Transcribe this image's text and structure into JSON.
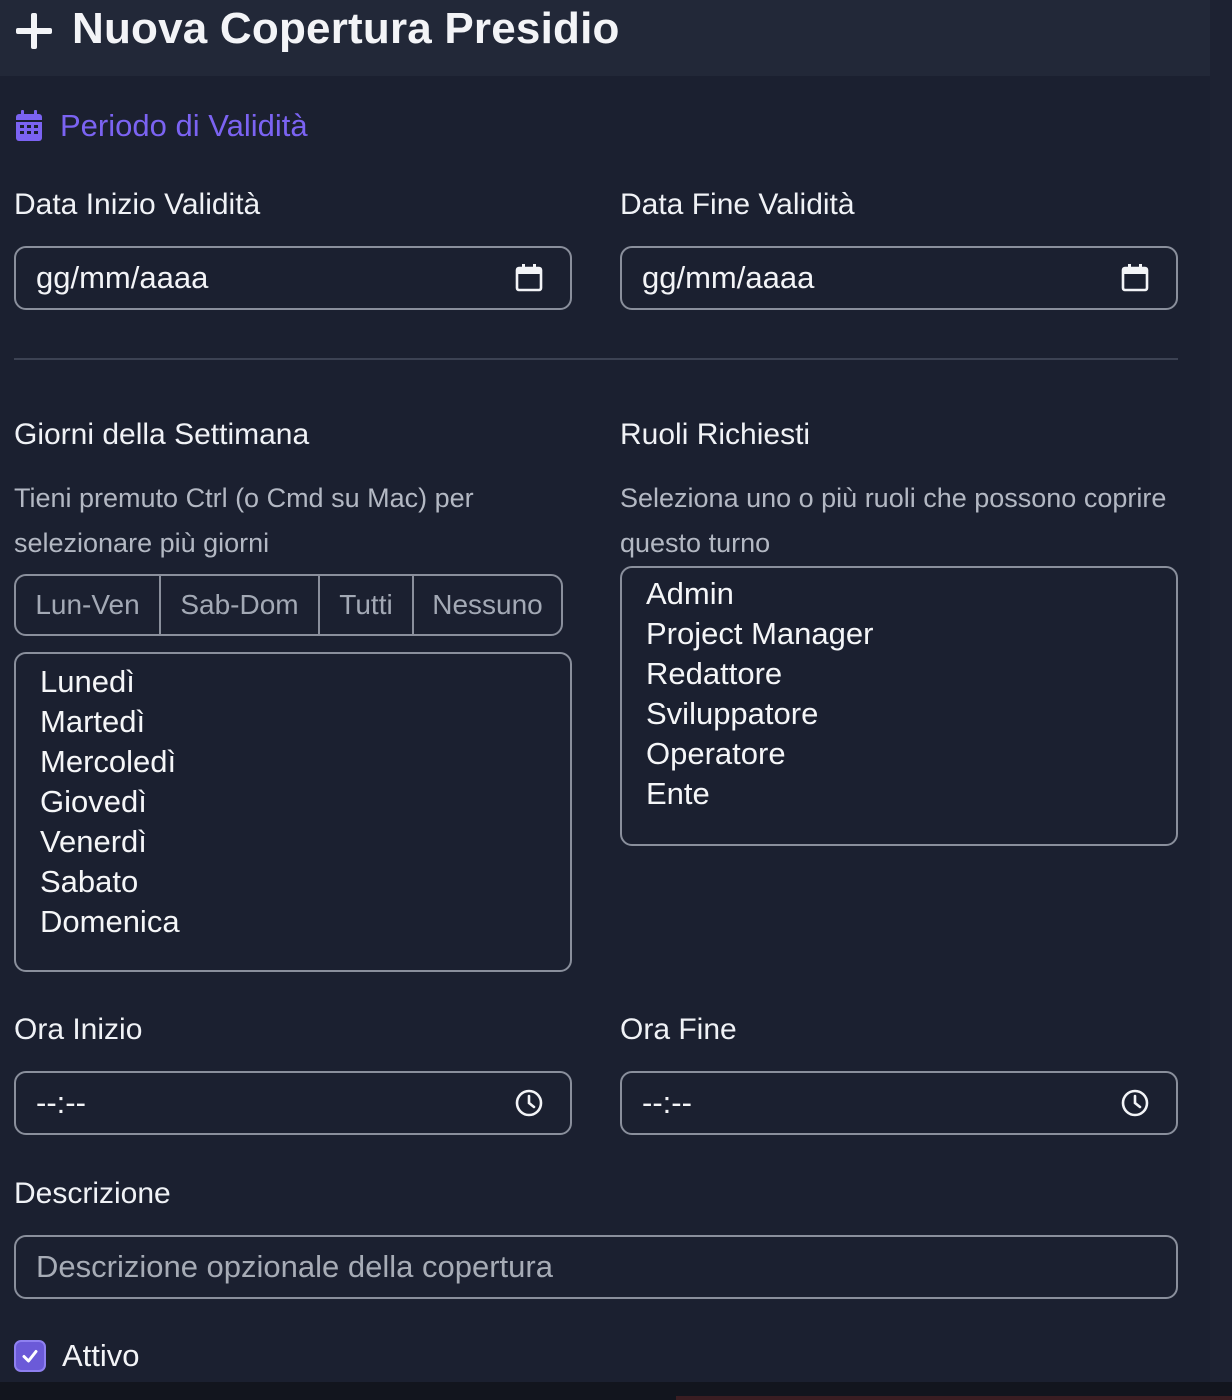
{
  "header": {
    "title": "Nuova Copertura Presidio",
    "icon": "plus-icon"
  },
  "section": {
    "title": "Periodo di Validità",
    "icon": "calendar-icon",
    "color": "#7b63f2"
  },
  "validity": {
    "start_label": "Data Inizio Validità",
    "start_value": "gg/mm/aaaa",
    "end_label": "Data Fine Validità",
    "end_value": "gg/mm/aaaa"
  },
  "days": {
    "label": "Giorni della Settimana",
    "hint": "Tieni premuto Ctrl (o Cmd su Mac) per selezionare più giorni",
    "quick_buttons": [
      "Lun-Ven",
      "Sab-Dom",
      "Tutti",
      "Nessuno"
    ],
    "options": [
      "Lunedì",
      "Martedì",
      "Mercoledì",
      "Giovedì",
      "Venerdì",
      "Sabato",
      "Domenica"
    ]
  },
  "roles": {
    "label": "Ruoli Richiesti",
    "hint": "Seleziona uno o più ruoli che possono coprire questo turno",
    "options": [
      "Admin",
      "Project Manager",
      "Redattore",
      "Sviluppatore",
      "Operatore",
      "Ente"
    ]
  },
  "time": {
    "start_label": "Ora Inizio",
    "start_value": "--:--",
    "end_label": "Ora Fine",
    "end_value": "--:--"
  },
  "description": {
    "label": "Descrizione",
    "placeholder": "Descrizione opzionale della copertura"
  },
  "active": {
    "label": "Attivo",
    "checked": true,
    "accent": "#6b5ad8"
  }
}
